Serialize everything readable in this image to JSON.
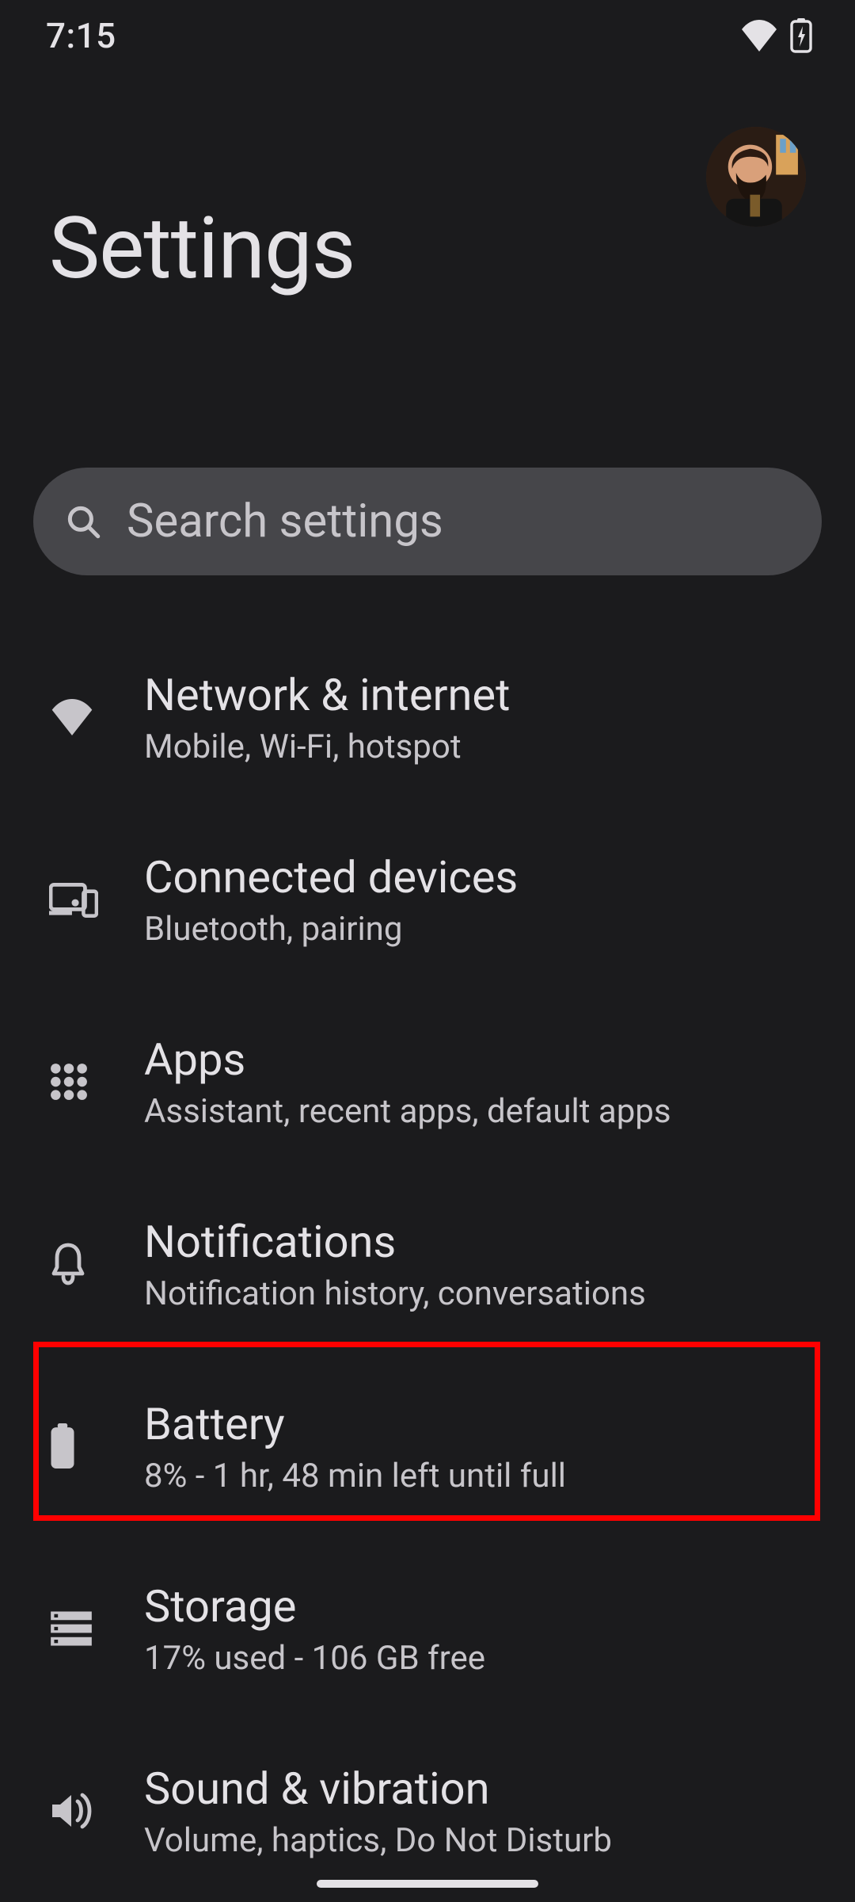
{
  "status": {
    "time": "7:15"
  },
  "header": {
    "title": "Settings"
  },
  "search": {
    "placeholder": "Search settings"
  },
  "items": [
    {
      "id": "network",
      "icon": "wifi",
      "title": "Network & internet",
      "sub": "Mobile, Wi-Fi, hotspot"
    },
    {
      "id": "connected",
      "icon": "devices",
      "title": "Connected devices",
      "sub": "Bluetooth, pairing"
    },
    {
      "id": "apps",
      "icon": "apps",
      "title": "Apps",
      "sub": "Assistant, recent apps, default apps"
    },
    {
      "id": "notifications",
      "icon": "bell",
      "title": "Notifications",
      "sub": "Notification history, conversations"
    },
    {
      "id": "battery",
      "icon": "battery",
      "title": "Battery",
      "sub": "8% - 1 hr, 48 min left until full"
    },
    {
      "id": "storage",
      "icon": "storage",
      "title": "Storage",
      "sub": "17% used - 106 GB free"
    },
    {
      "id": "sound",
      "icon": "sound",
      "title": "Sound & vibration",
      "sub": "Volume, haptics, Do Not Disturb"
    }
  ],
  "highlighted_item": "battery"
}
